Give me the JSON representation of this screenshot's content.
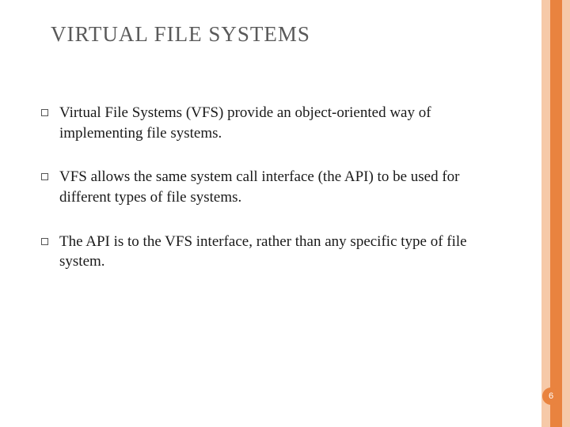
{
  "title": "VIRTUAL FILE SYSTEMS",
  "bullets": [
    "Virtual File Systems (VFS) provide an object-oriented way of implementing file systems.",
    "VFS allows the same system call interface (the API) to be used for different types of file systems.",
    "The API is to the VFS interface, rather than any specific type of file system."
  ],
  "page_number": "6",
  "theme": {
    "accent_light": "#f6c9a8",
    "accent_dark": "#e9833f"
  }
}
